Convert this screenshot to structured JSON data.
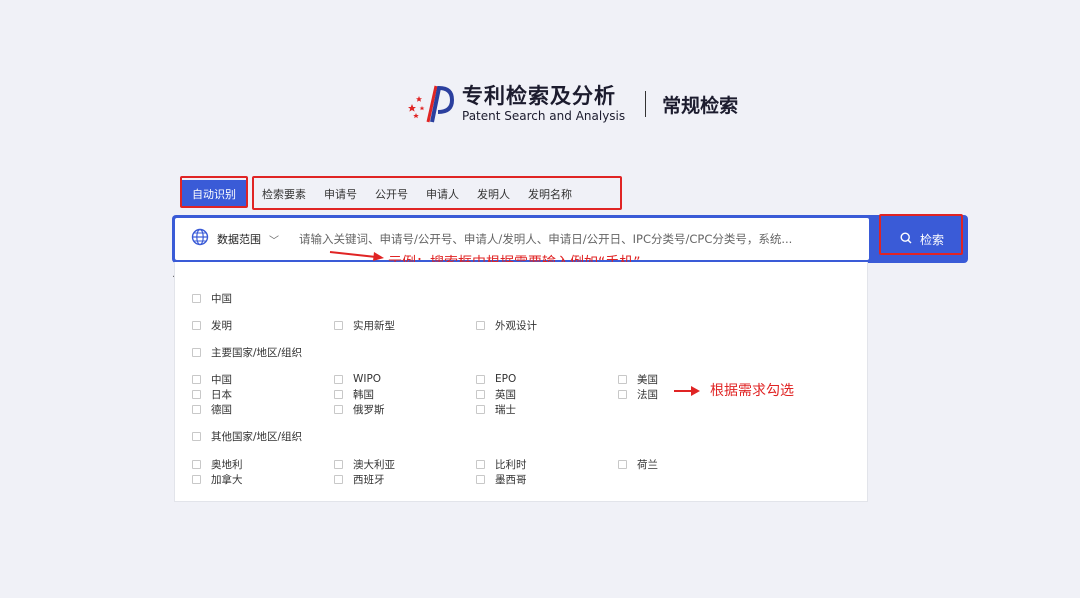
{
  "brand": {
    "name_cn": "专利检索及分析",
    "name_en": "Patent Search and Analysis",
    "page_title": "常规检索"
  },
  "tabs": {
    "active": "自动识别",
    "items": [
      "检索要素",
      "申请号",
      "公开号",
      "申请人",
      "发明人",
      "发明名称"
    ]
  },
  "search": {
    "scope_label": "数据范围",
    "placeholder": "请输入关键词、申请号/公开号、申请人/发明人、申请日/公开日、IPC分类号/CPC分类号，系统...",
    "button_label": "检索"
  },
  "annotations": {
    "example": "示例：搜索框中根据需要输入例如“手机”",
    "select_hint": "根据需求勾选"
  },
  "panel": {
    "china": "中国",
    "types": [
      "发明",
      "实用新型",
      "外观设计"
    ],
    "major_label": "主要国家/地区/组织",
    "major": {
      "col1": [
        "中国",
        "日本",
        "德国"
      ],
      "col2": [
        "WIPO",
        "韩国",
        "俄罗斯"
      ],
      "col3": [
        "EPO",
        "英国",
        "瑞士"
      ],
      "col4": [
        "美国",
        "法国"
      ]
    },
    "other_label": "其他国家/地区/组织",
    "other": {
      "col1": [
        "奥地利",
        "加拿大"
      ],
      "col2": [
        "澳大利亚",
        "西班牙"
      ],
      "col3": [
        "比利时",
        "墨西哥"
      ],
      "col4": [
        "荷兰"
      ]
    }
  },
  "colors": {
    "primary": "#3a5bd7",
    "annotation_red": "#e02424",
    "background": "#f0f1f7"
  }
}
